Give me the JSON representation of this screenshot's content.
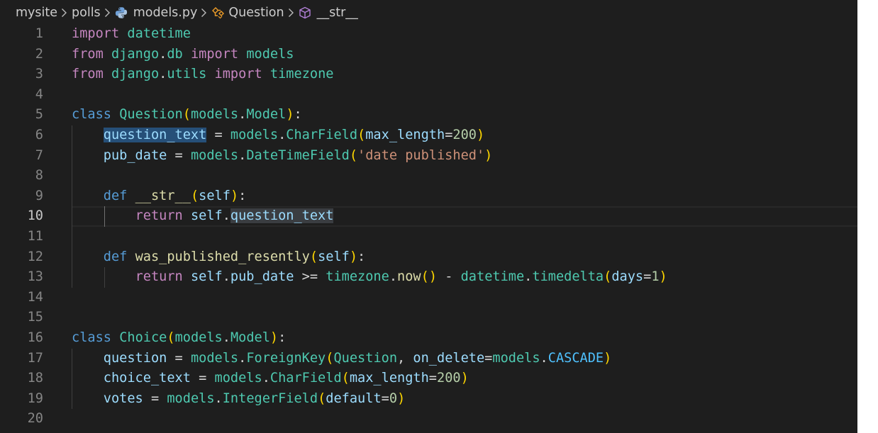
{
  "breadcrumb": {
    "items": [
      {
        "label": "mysite",
        "icon": null
      },
      {
        "label": "polls",
        "icon": null
      },
      {
        "label": "models.py",
        "icon": "python-file-icon"
      },
      {
        "label": "Question",
        "icon": "class-symbol-icon"
      },
      {
        "label": "__str__",
        "icon": "method-symbol-icon"
      }
    ],
    "separator_icon": "chevron-right-icon"
  },
  "editor": {
    "current_line": 10,
    "selected_word": "question_text",
    "colors": {
      "background": "#1e1e1e",
      "keyword": "#569cd6",
      "control": "#c586c0",
      "class": "#4ec9b0",
      "function": "#dcdcaa",
      "variable": "#9cdcfe",
      "number": "#b5cea8",
      "string": "#ce9178",
      "bracket_level_1": "#ffd700",
      "bracket_level_2": "#da70d6",
      "selection": "#264f78"
    },
    "lines": [
      {
        "number": "1",
        "indent": 0,
        "tokens": [
          {
            "t": "import",
            "c": "ctl"
          },
          {
            "t": " "
          },
          {
            "t": "datetime",
            "c": "cls"
          }
        ]
      },
      {
        "number": "2",
        "indent": 0,
        "tokens": [
          {
            "t": "from",
            "c": "ctl"
          },
          {
            "t": " "
          },
          {
            "t": "django",
            "c": "cls"
          },
          {
            "t": "."
          },
          {
            "t": "db",
            "c": "cls"
          },
          {
            "t": " "
          },
          {
            "t": "import",
            "c": "ctl"
          },
          {
            "t": " "
          },
          {
            "t": "models",
            "c": "cls"
          }
        ]
      },
      {
        "number": "3",
        "indent": 0,
        "tokens": [
          {
            "t": "from",
            "c": "ctl"
          },
          {
            "t": " "
          },
          {
            "t": "django",
            "c": "cls"
          },
          {
            "t": "."
          },
          {
            "t": "utils",
            "c": "cls"
          },
          {
            "t": " "
          },
          {
            "t": "import",
            "c": "ctl"
          },
          {
            "t": " "
          },
          {
            "t": "timezone",
            "c": "cls"
          }
        ]
      },
      {
        "number": "4",
        "indent": 0,
        "tokens": []
      },
      {
        "number": "5",
        "indent": 0,
        "tokens": [
          {
            "t": "class",
            "c": "kw"
          },
          {
            "t": " "
          },
          {
            "t": "Question",
            "c": "cls"
          },
          {
            "t": "(",
            "c": "b1"
          },
          {
            "t": "models",
            "c": "cls"
          },
          {
            "t": "."
          },
          {
            "t": "Model",
            "c": "cls"
          },
          {
            "t": ")",
            "c": "b1"
          },
          {
            "t": ":"
          }
        ]
      },
      {
        "number": "6",
        "indent": 1,
        "tokens": [
          {
            "t": "    "
          },
          {
            "t": "question_text",
            "c": "var",
            "h": "sel"
          },
          {
            "t": " = "
          },
          {
            "t": "models",
            "c": "cls"
          },
          {
            "t": "."
          },
          {
            "t": "CharField",
            "c": "cls"
          },
          {
            "t": "(",
            "c": "b1"
          },
          {
            "t": "max_length",
            "c": "var"
          },
          {
            "t": "="
          },
          {
            "t": "200",
            "c": "num"
          },
          {
            "t": ")",
            "c": "b1"
          }
        ]
      },
      {
        "number": "7",
        "indent": 1,
        "tokens": [
          {
            "t": "    "
          },
          {
            "t": "pub_date",
            "c": "var"
          },
          {
            "t": " = "
          },
          {
            "t": "models",
            "c": "cls"
          },
          {
            "t": "."
          },
          {
            "t": "DateTimeField",
            "c": "cls"
          },
          {
            "t": "(",
            "c": "b1"
          },
          {
            "t": "'date published'",
            "c": "str"
          },
          {
            "t": ")",
            "c": "b1"
          }
        ]
      },
      {
        "number": "8",
        "indent": 1,
        "tokens": []
      },
      {
        "number": "9",
        "indent": 1,
        "tokens": [
          {
            "t": "    "
          },
          {
            "t": "def",
            "c": "kw"
          },
          {
            "t": " "
          },
          {
            "t": "__str__",
            "c": "fn"
          },
          {
            "t": "(",
            "c": "b1"
          },
          {
            "t": "self",
            "c": "var"
          },
          {
            "t": ")",
            "c": "b1"
          },
          {
            "t": ":"
          }
        ]
      },
      {
        "number": "10",
        "indent": 2,
        "tokens": [
          {
            "t": "        "
          },
          {
            "t": "return",
            "c": "ctl"
          },
          {
            "t": " "
          },
          {
            "t": "self",
            "c": "var"
          },
          {
            "t": "."
          },
          {
            "t": "question_text",
            "c": "var",
            "h": "word"
          }
        ]
      },
      {
        "number": "11",
        "indent": 1,
        "tokens": []
      },
      {
        "number": "12",
        "indent": 1,
        "tokens": [
          {
            "t": "    "
          },
          {
            "t": "def",
            "c": "kw"
          },
          {
            "t": " "
          },
          {
            "t": "was_published_resently",
            "c": "fn"
          },
          {
            "t": "(",
            "c": "b1"
          },
          {
            "t": "self",
            "c": "var"
          },
          {
            "t": ")",
            "c": "b1"
          },
          {
            "t": ":"
          }
        ]
      },
      {
        "number": "13",
        "indent": 2,
        "tokens": [
          {
            "t": "        "
          },
          {
            "t": "return",
            "c": "ctl"
          },
          {
            "t": " "
          },
          {
            "t": "self",
            "c": "var"
          },
          {
            "t": "."
          },
          {
            "t": "pub_date",
            "c": "var"
          },
          {
            "t": " >= "
          },
          {
            "t": "timezone",
            "c": "cls"
          },
          {
            "t": "."
          },
          {
            "t": "now",
            "c": "fn"
          },
          {
            "t": "()",
            "c": "b1"
          },
          {
            "t": " - "
          },
          {
            "t": "datetime",
            "c": "cls"
          },
          {
            "t": "."
          },
          {
            "t": "timedelta",
            "c": "cls"
          },
          {
            "t": "(",
            "c": "b1"
          },
          {
            "t": "days",
            "c": "var"
          },
          {
            "t": "="
          },
          {
            "t": "1",
            "c": "num"
          },
          {
            "t": ")",
            "c": "b1"
          }
        ]
      },
      {
        "number": "14",
        "indent": 0,
        "tokens": []
      },
      {
        "number": "15",
        "indent": 0,
        "tokens": []
      },
      {
        "number": "16",
        "indent": 0,
        "tokens": [
          {
            "t": "class",
            "c": "kw"
          },
          {
            "t": " "
          },
          {
            "t": "Choice",
            "c": "cls"
          },
          {
            "t": "(",
            "c": "b1"
          },
          {
            "t": "models",
            "c": "cls"
          },
          {
            "t": "."
          },
          {
            "t": "Model",
            "c": "cls"
          },
          {
            "t": ")",
            "c": "b1"
          },
          {
            "t": ":"
          }
        ]
      },
      {
        "number": "17",
        "indent": 1,
        "tokens": [
          {
            "t": "    "
          },
          {
            "t": "question",
            "c": "var"
          },
          {
            "t": " = "
          },
          {
            "t": "models",
            "c": "cls"
          },
          {
            "t": "."
          },
          {
            "t": "ForeignKey",
            "c": "cls"
          },
          {
            "t": "(",
            "c": "b1"
          },
          {
            "t": "Question",
            "c": "cls"
          },
          {
            "t": ", "
          },
          {
            "t": "on_delete",
            "c": "var"
          },
          {
            "t": "="
          },
          {
            "t": "models",
            "c": "cls"
          },
          {
            "t": "."
          },
          {
            "t": "CASCADE",
            "c": "const"
          },
          {
            "t": ")",
            "c": "b1"
          }
        ]
      },
      {
        "number": "18",
        "indent": 1,
        "tokens": [
          {
            "t": "    "
          },
          {
            "t": "choice_text",
            "c": "var"
          },
          {
            "t": " = "
          },
          {
            "t": "models",
            "c": "cls"
          },
          {
            "t": "."
          },
          {
            "t": "CharField",
            "c": "cls"
          },
          {
            "t": "(",
            "c": "b1"
          },
          {
            "t": "max_length",
            "c": "var"
          },
          {
            "t": "="
          },
          {
            "t": "200",
            "c": "num"
          },
          {
            "t": ")",
            "c": "b1"
          }
        ]
      },
      {
        "number": "19",
        "indent": 1,
        "tokens": [
          {
            "t": "    "
          },
          {
            "t": "votes",
            "c": "var"
          },
          {
            "t": " = "
          },
          {
            "t": "models",
            "c": "cls"
          },
          {
            "t": "."
          },
          {
            "t": "IntegerField",
            "c": "cls"
          },
          {
            "t": "(",
            "c": "b1"
          },
          {
            "t": "default",
            "c": "var"
          },
          {
            "t": "="
          },
          {
            "t": "0",
            "c": "num"
          },
          {
            "t": ")",
            "c": "b1"
          }
        ]
      },
      {
        "number": "20",
        "indent": 0,
        "tokens": []
      }
    ]
  }
}
